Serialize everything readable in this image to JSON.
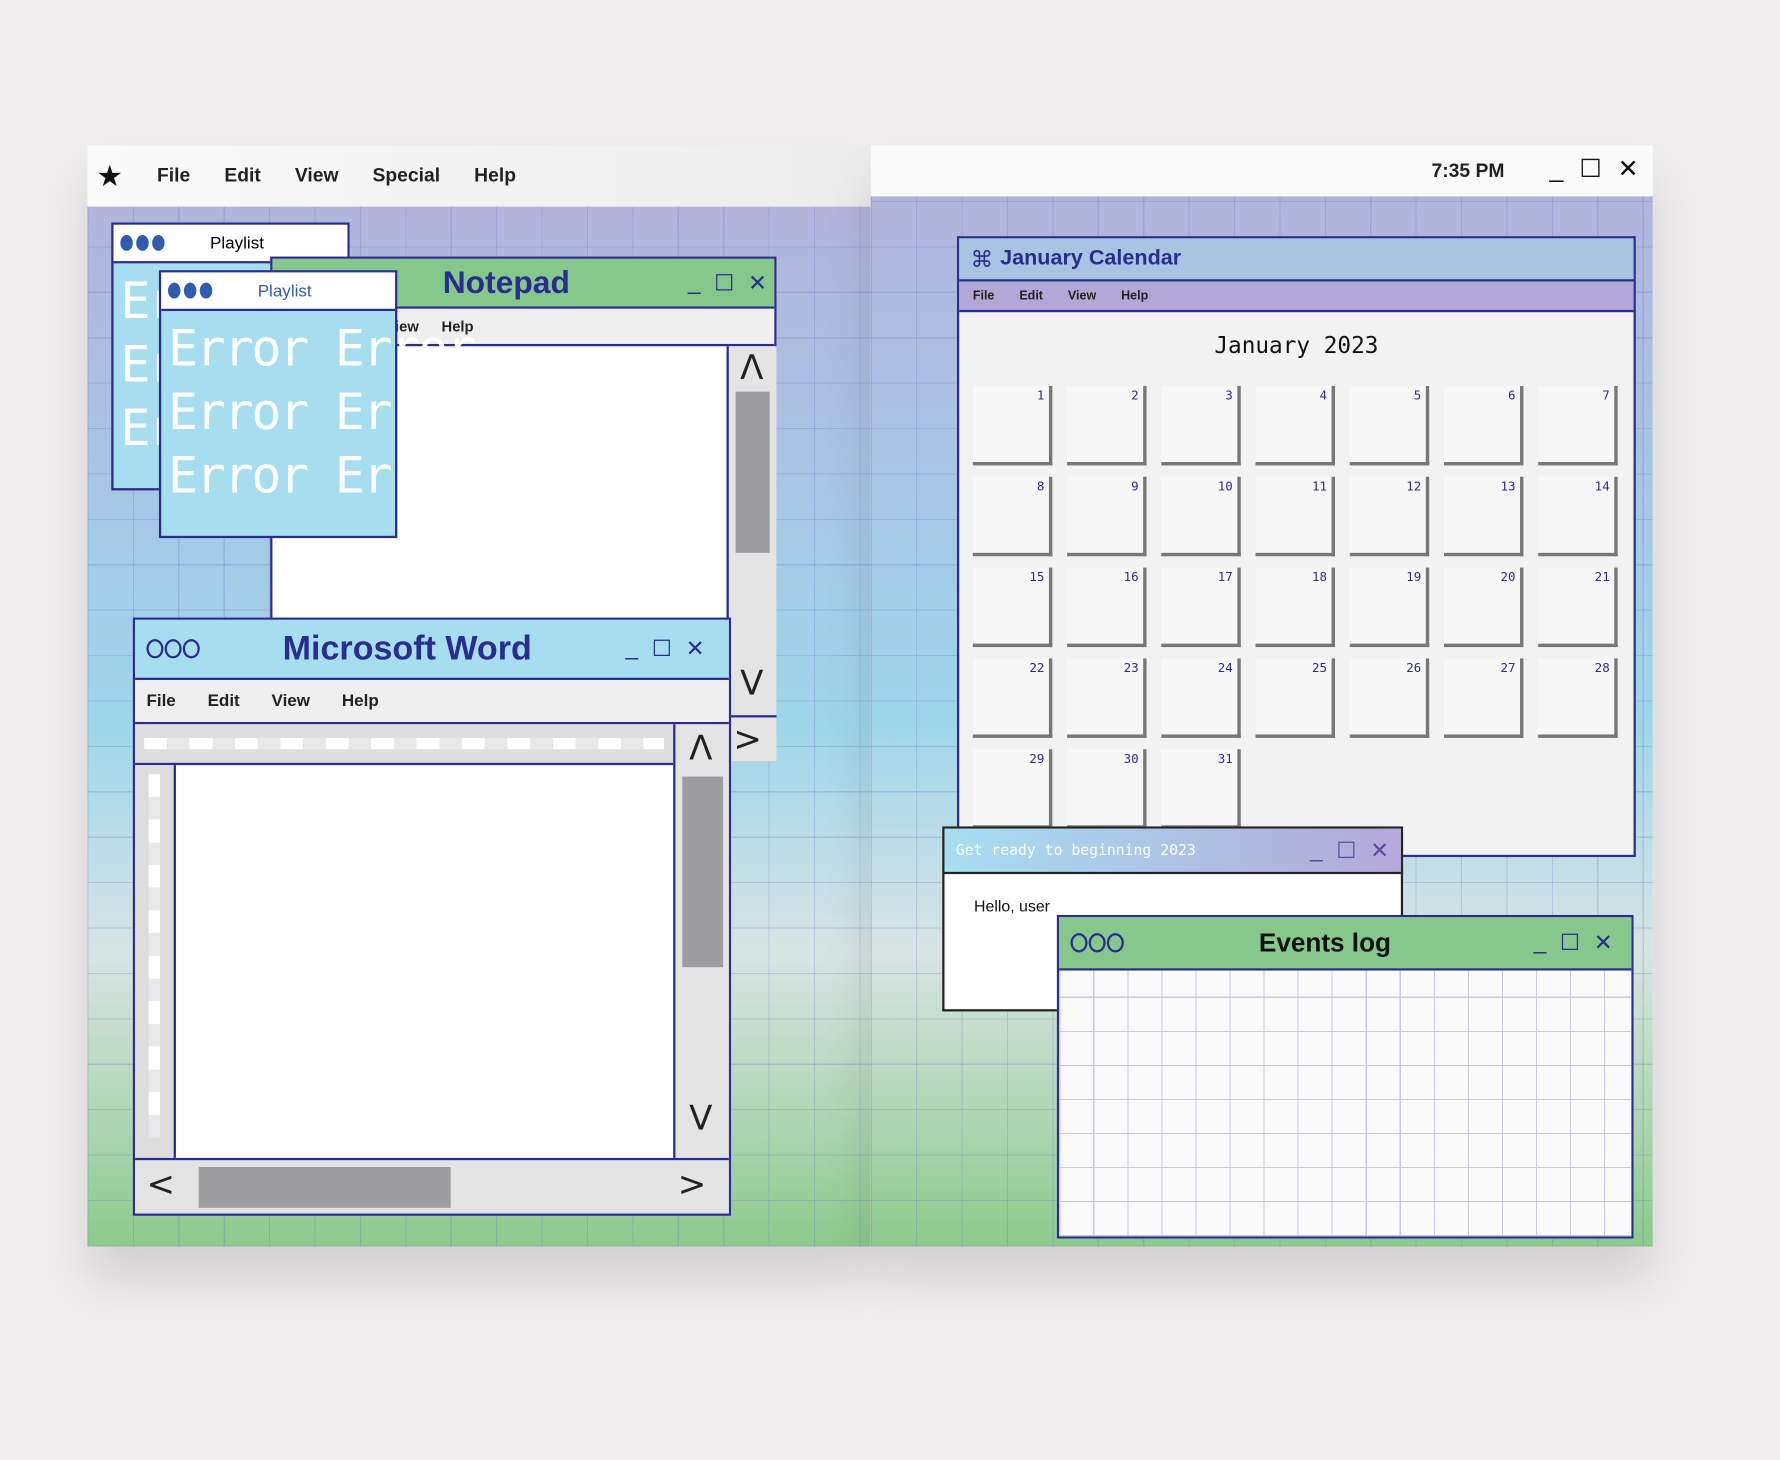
{
  "left_page": {
    "menu": [
      "File",
      "Edit",
      "View",
      "Special",
      "Help"
    ],
    "logo_icon": "star-icon"
  },
  "right_page": {
    "clock": "7:35 PM"
  },
  "playlist_back": {
    "title": "Playlist",
    "text": [
      "Er",
      "Er",
      "Er"
    ]
  },
  "playlist_front": {
    "title": "Playlist",
    "text": [
      "Error Error",
      "Error Error",
      "Error Error"
    ]
  },
  "notepad": {
    "title": "Notepad",
    "menu": [
      "iew",
      "Help"
    ]
  },
  "word": {
    "title": "Microsoft Word",
    "menu": [
      "File",
      "Edit",
      "View",
      "Help"
    ]
  },
  "calendar": {
    "title": "January Calendar",
    "menu": [
      "File",
      "Edit",
      "View",
      "Help"
    ],
    "month": "January 2023",
    "days": [
      "1",
      "2",
      "3",
      "4",
      "5",
      "6",
      "7",
      "8",
      "9",
      "10",
      "11",
      "12",
      "13",
      "14",
      "15",
      "16",
      "17",
      "18",
      "19",
      "20",
      "21",
      "22",
      "23",
      "24",
      "25",
      "26",
      "27",
      "28",
      "29",
      "30",
      "31"
    ]
  },
  "greeting": {
    "title": "Get ready to beginning 2023",
    "message": "Hello, user"
  },
  "events": {
    "title": "Events log"
  },
  "colors": {
    "border": "#2a2d8f",
    "green_title": "#86c88c",
    "blue_title": "#a6def0",
    "accent_text": "#2a2d8f"
  }
}
